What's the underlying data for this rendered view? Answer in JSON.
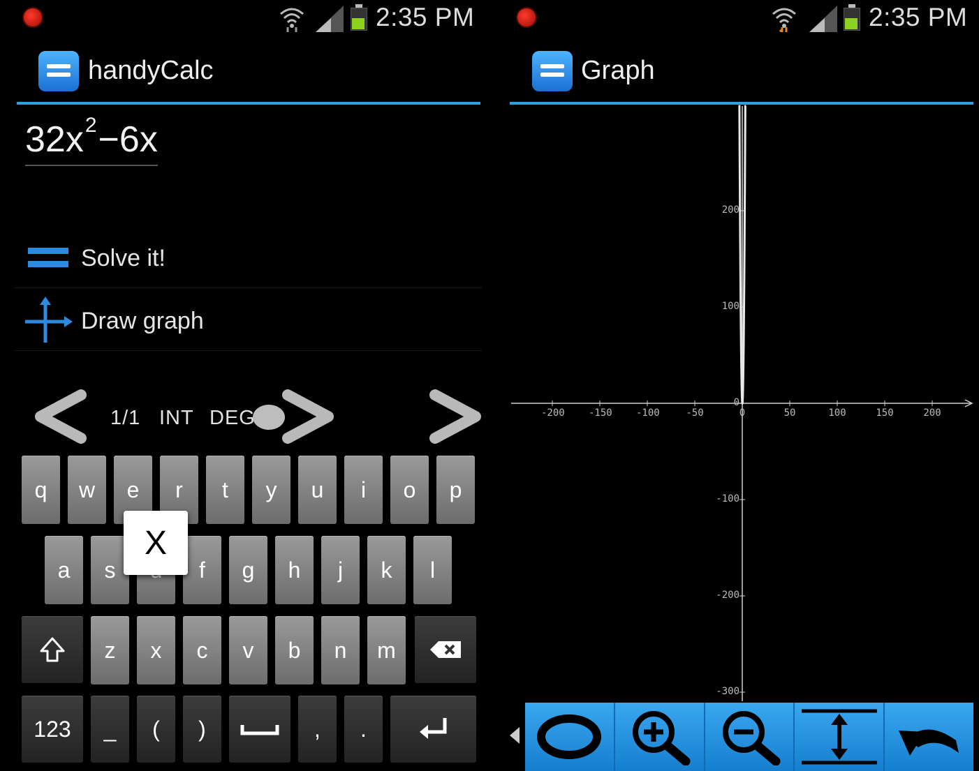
{
  "status_left": {
    "time": "2:35 PM"
  },
  "status_right": {
    "time": "2:35 PM"
  },
  "calc": {
    "title": "handyCalc",
    "expression": {
      "base": "32x",
      "exponent": "2",
      "rest": "−6x"
    },
    "menu": [
      {
        "label": "Solve it!",
        "icon": "equals-icon"
      },
      {
        "label": "Draw graph",
        "icon": "axes-icon"
      }
    ],
    "mode": {
      "page": "1/1",
      "int": "INT",
      "deg": "DEG"
    }
  },
  "keyboard": {
    "row1": [
      "q",
      "w",
      "e",
      "r",
      "t",
      "y",
      "u",
      "i",
      "o",
      "p"
    ],
    "row2": [
      "a",
      "s",
      "d",
      "f",
      "g",
      "h",
      "j",
      "k",
      "l"
    ],
    "row3": [
      "z",
      "x",
      "c",
      "v",
      "b",
      "n",
      "m"
    ],
    "num_label": "123",
    "row4_symbols": [
      "_",
      "(",
      ")",
      ",",
      "."
    ],
    "popup_key": "X"
  },
  "graph": {
    "title": "Graph",
    "chart_data": {
      "type": "line",
      "title": "",
      "xlabel": "",
      "ylabel": "",
      "x_ticks": [
        -200,
        -150,
        -100,
        -50,
        0,
        50,
        100,
        150,
        200
      ],
      "y_ticks": [
        200,
        100,
        0,
        -100,
        -200,
        -300
      ],
      "xlim": [
        -245,
        240
      ],
      "ylim": [
        -310,
        310
      ],
      "grid": false,
      "series": [
        {
          "expression": "32x^2-6x"
        }
      ]
    },
    "toolbar": [
      "reset-icon",
      "zoom-in-icon",
      "zoom-out-icon",
      "fit-vertical-icon",
      "undo-icon"
    ]
  }
}
